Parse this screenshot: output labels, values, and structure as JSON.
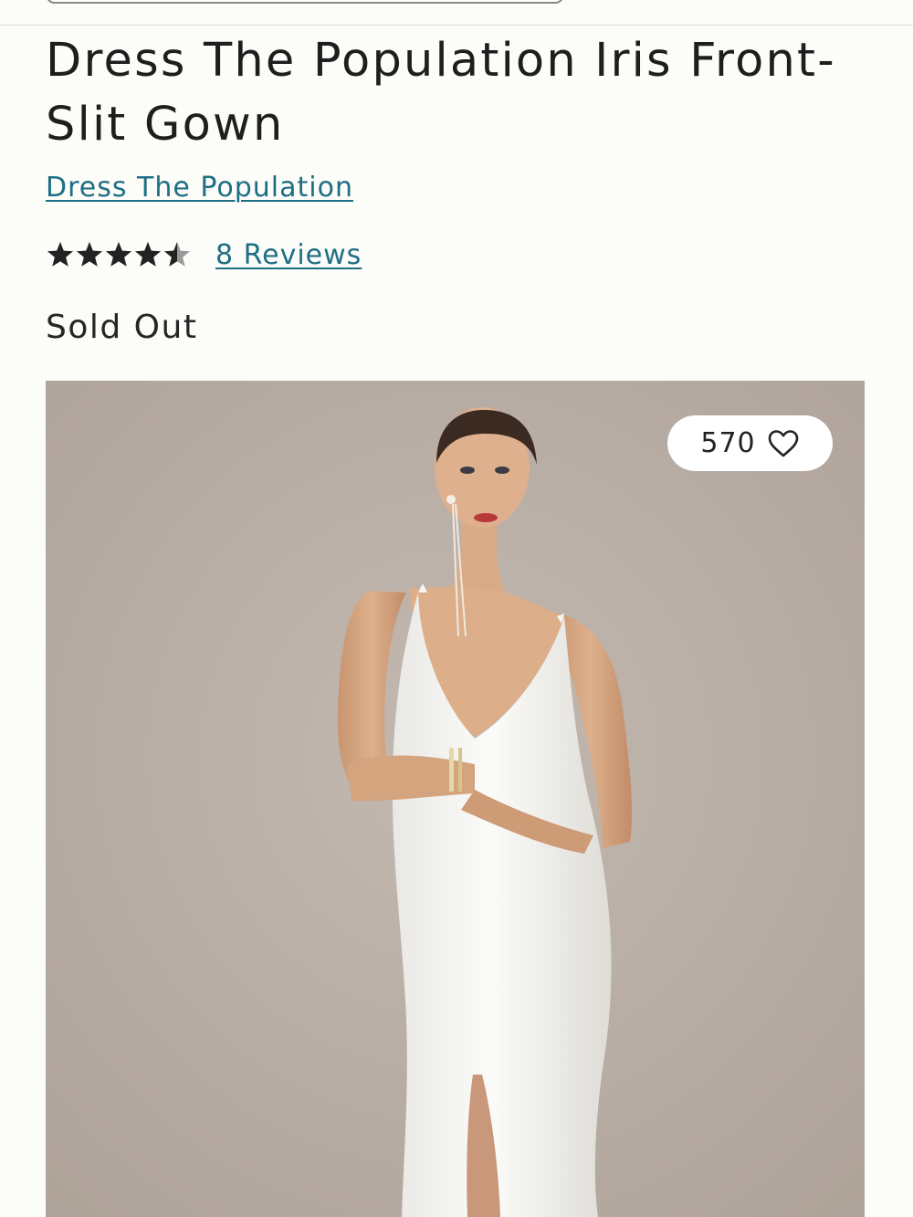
{
  "product": {
    "title": "Dress The Population Iris Front-Slit Gown",
    "brand": "Dress The Population",
    "rating": 4.5,
    "rating_max": 5,
    "reviews_label": "8 Reviews",
    "status": "Sold Out"
  },
  "favorites": {
    "count": "570",
    "icon": "heart-outline-icon"
  },
  "image": {
    "subject": "model-in-white-gown",
    "background_color": "#b9aea6"
  },
  "colors": {
    "link": "#1f6f84",
    "text": "#1e1e1e",
    "page_background": "#fcfcf9",
    "star_filled": "#222222",
    "star_empty": "#9a9a9a"
  }
}
